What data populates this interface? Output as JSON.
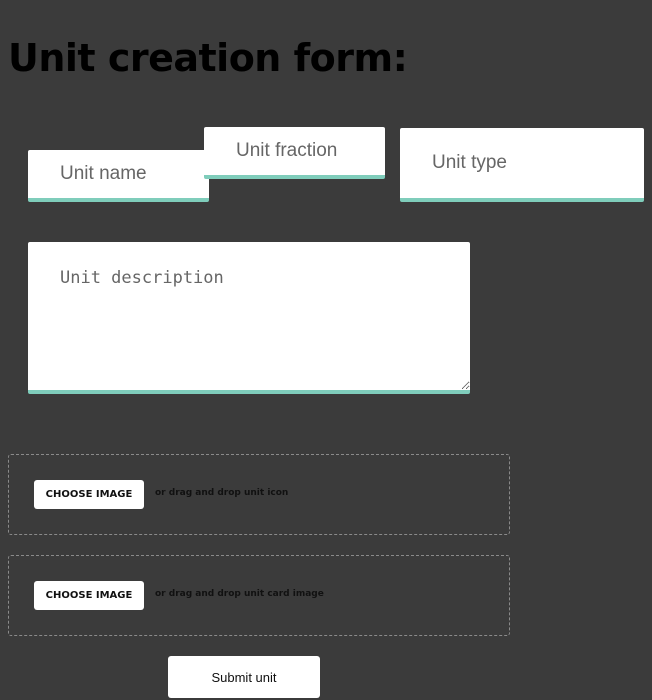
{
  "form": {
    "title": "Unit creation form:",
    "unit_name_placeholder": "Unit name",
    "unit_fraction_placeholder": "Unit fraction",
    "unit_type_placeholder": "Unit type",
    "unit_description_placeholder": "Unit description"
  },
  "uploads": {
    "icon": {
      "button_label": "CHOOSE IMAGE",
      "hint": "or drag and drop unit icon"
    },
    "card": {
      "button_label": "CHOOSE IMAGE",
      "hint": "or drag and drop unit card image"
    }
  },
  "submit_label": "Submit unit",
  "colors": {
    "background": "#3b3b3b",
    "field_accent": "#7fcdbb"
  }
}
